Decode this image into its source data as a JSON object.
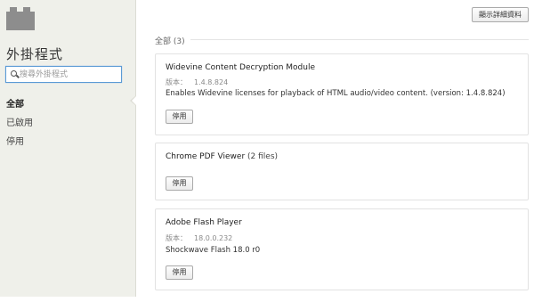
{
  "sidebar": {
    "title": "外掛程式",
    "search_placeholder": "搜尋外掛程式",
    "nav": [
      {
        "label": "全部"
      },
      {
        "label": "已啟用"
      },
      {
        "label": "停用"
      }
    ]
  },
  "toolbar": {
    "details_label": "顯示詳細資料"
  },
  "section": {
    "header": "全部 (3)"
  },
  "plugins": [
    {
      "name": "Widevine Content Decryption Module",
      "version_label": "版本：",
      "version": "1.4.8.824",
      "description": "Enables Widevine licenses for playback of HTML audio/video content. (version: 1.4.8.824)",
      "disable_label": "停用"
    },
    {
      "name": "Chrome PDF Viewer",
      "files": "(2 files)",
      "disable_label": "停用"
    },
    {
      "name": "Adobe Flash Player",
      "version_label": "版本：",
      "version": "18.0.0.232",
      "description": "Shockwave Flash 18.0 r0",
      "disable_label": "停用"
    }
  ]
}
